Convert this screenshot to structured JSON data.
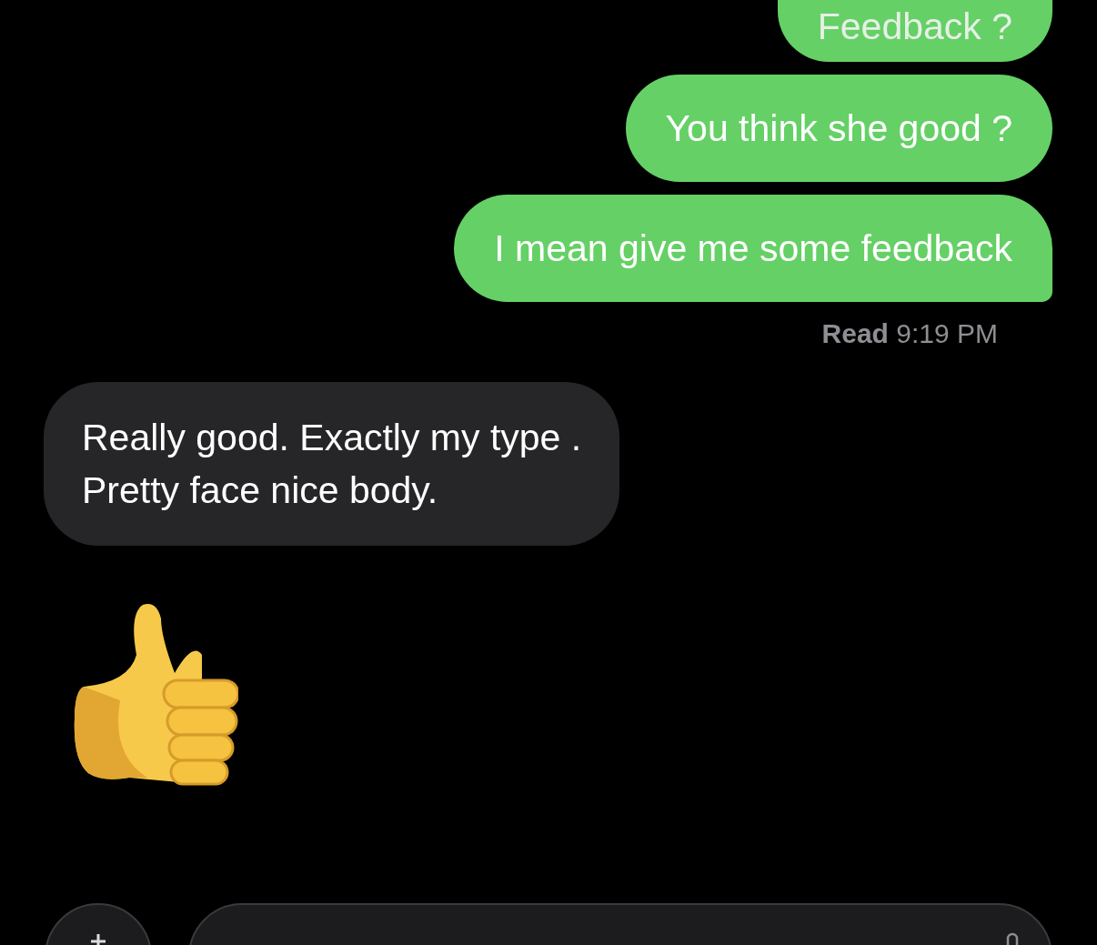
{
  "messages": [
    {
      "kind": "text",
      "outgoing": true,
      "text": "Feedback ?",
      "tail": false
    },
    {
      "kind": "text",
      "outgoing": true,
      "text": "You think she good ?",
      "tail": false
    },
    {
      "kind": "text",
      "outgoing": true,
      "text": "I mean give me some feedback",
      "tail": true
    },
    {
      "kind": "receipt",
      "text": "**Read** 9:19 PM"
    },
    {
      "kind": "text",
      "outgoing": false,
      "text": "Really good. Exactly my type .\nPretty face nice body.",
      "tail": false
    },
    {
      "kind": "emoji",
      "outgoing": false
    }
  ],
  "composer": {
    "kind": "field"
  }
}
